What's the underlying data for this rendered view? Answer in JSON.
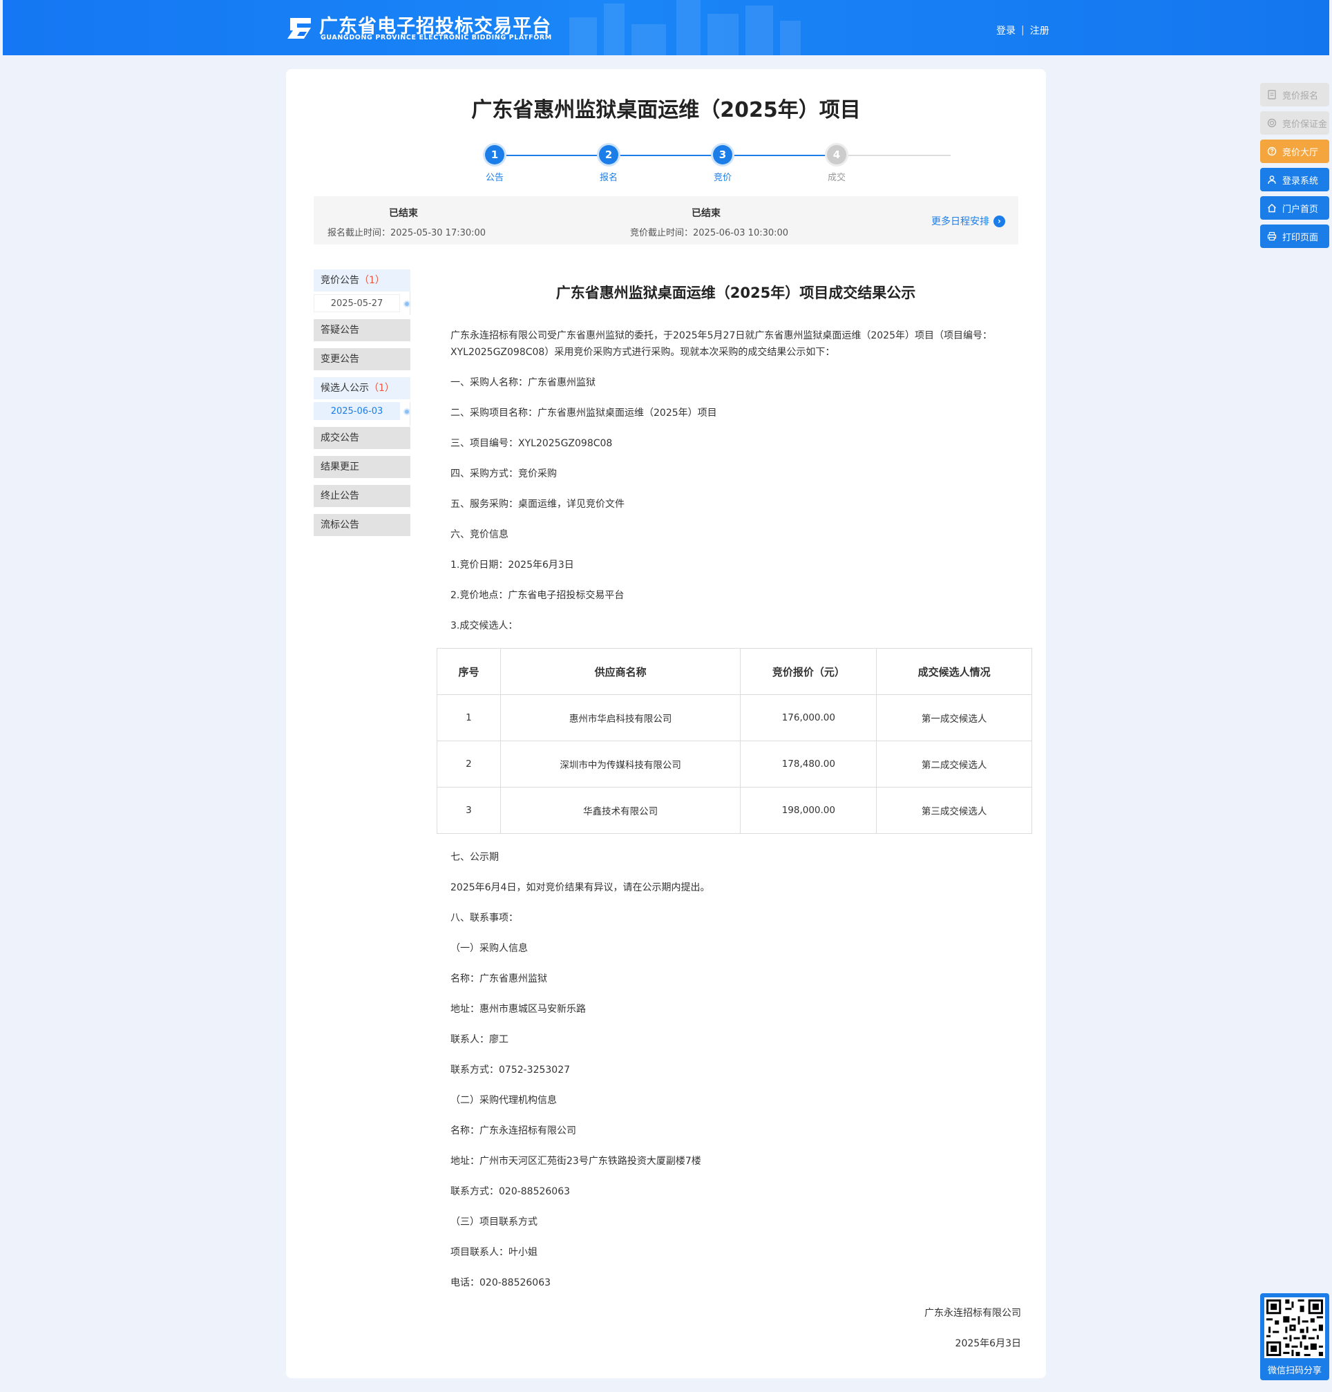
{
  "header": {
    "logo_cn": "广东省电子招投标交易平台",
    "logo_en": "GUANGDONG PROVINCE ELECTRONIC BIDDING PLATFORM",
    "login": "登录",
    "separator": "|",
    "register": "注册"
  },
  "project": {
    "title": "广东省惠州监狱桌面运维（2025年）项目"
  },
  "steps": [
    {
      "num": "1",
      "label": "公告",
      "state": "active"
    },
    {
      "num": "2",
      "label": "报名",
      "state": "active"
    },
    {
      "num": "3",
      "label": "竞价",
      "state": "active"
    },
    {
      "num": "4",
      "label": "成交",
      "state": "todo"
    }
  ],
  "schedule": {
    "items": [
      {
        "status": "已结束",
        "time": "报名截止时间：2025-05-30 17:30:00"
      },
      {
        "status": "已结束",
        "time": "竞价截止时间：2025-06-03 10:30:00"
      }
    ],
    "more": "更多日程安排"
  },
  "leftnav": {
    "items": [
      {
        "label": "竞价公告",
        "count": "（1）",
        "sub": "2025-05-27"
      },
      {
        "label": "答疑公告"
      },
      {
        "label": "变更公告"
      },
      {
        "label": "候选人公示",
        "count": "（1）",
        "sub": "2025-06-03"
      },
      {
        "label": "成交公告"
      },
      {
        "label": "结果更正"
      },
      {
        "label": "终止公告"
      },
      {
        "label": "流标公告"
      }
    ]
  },
  "notice": {
    "title": "广东省惠州监狱桌面运维（2025年）项目成交结果公示",
    "intro": "广东永连招标有限公司受广东省惠州监狱的委托，于2025年5月27日就广东省惠州监狱桌面运维（2025年）项目（项目编号：XYL2025GZ098C08）采用竞价采购方式进行采购。现就本次采购的成交结果公示如下：",
    "items_before_table": [
      "一、采购人名称：广东省惠州监狱",
      "二、采购项目名称：广东省惠州监狱桌面运维（2025年）项目",
      "三、项目编号：XYL2025GZ098C08",
      "四、采购方式：竞价采购",
      "五、服务采购：桌面运维，详见竞价文件",
      "六、竞价信息",
      "1.竞价日期：2025年6月3日",
      "2.竞价地点：广东省电子招投标交易平台",
      "3.成交候选人："
    ],
    "table": {
      "headers": [
        "序号",
        "供应商名称",
        "竞价报价（元）",
        "成交候选人情况"
      ],
      "rows": [
        [
          "1",
          "惠州市华启科技有限公司",
          "176,000.00",
          "第一成交候选人"
        ],
        [
          "2",
          "深圳市中为传媒科技有限公司",
          "178,480.00",
          "第二成交候选人"
        ],
        [
          "3",
          "华鑫技术有限公司",
          "198,000.00",
          "第三成交候选人"
        ]
      ]
    },
    "items_after_table": [
      "七、公示期",
      "2025年6月4日，如对竞价结果有异议，请在公示期内提出。",
      "八、联系事项：",
      "（一）采购人信息",
      "名称：广东省惠州监狱",
      "地址：惠州市惠城区马安新乐路",
      "联系人：廖工",
      "联系方式：0752-3253027",
      "（二）采购代理机构信息",
      "名称：广东永连招标有限公司",
      "地址：广州市天河区汇苑街23号广东铁路投资大厦副楼7楼",
      "联系方式：020-88526063",
      "（三）项目联系方式",
      "项目联系人：叶小姐",
      "电话：020-88526063"
    ],
    "signature": "广东永连招标有限公司",
    "date": "2025年6月3日"
  },
  "float_tools": [
    {
      "label": "竞价报名",
      "icon": "form-icon",
      "style": "disabled"
    },
    {
      "label": "竞价保证金",
      "icon": "coin-icon",
      "style": "disabled"
    },
    {
      "label": "竞价大厅",
      "icon": "help-circle-icon",
      "style": "orange"
    },
    {
      "label": "登录系统",
      "icon": "user-icon",
      "style": "blue"
    },
    {
      "label": "门户首页",
      "icon": "home-icon",
      "style": "blue"
    },
    {
      "label": "打印页面",
      "icon": "printer-icon",
      "style": "blue"
    }
  ],
  "qr": {
    "label": "微信扫码分享"
  },
  "colors": {
    "primary": "#1b7de8",
    "orange": "#f4a53d",
    "header": "#1577f3",
    "count_red": "#e8543e"
  }
}
